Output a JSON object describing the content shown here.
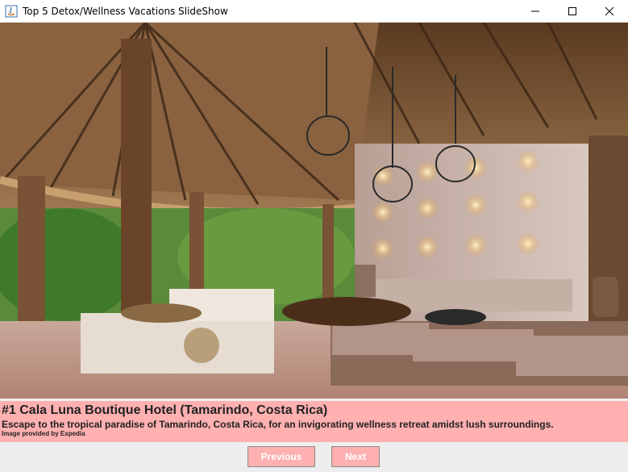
{
  "window": {
    "title": "Top 5 Detox/Wellness Vacations SlideShow",
    "controls": [
      "minimize-icon",
      "maximize-icon",
      "close-icon"
    ]
  },
  "slide": {
    "title": "#1 Cala Luna Boutique Hotel (Tamarindo, Costa Rica)",
    "description": "Escape to the tropical paradise of Tamarindo, Costa Rica, for an invigorating wellness retreat amidst lush surroundings.",
    "credit": "Image provided by Expedia"
  },
  "buttons": {
    "previous": "Previous",
    "next": "Next"
  },
  "colors": {
    "caption_bg": "#ffb0b0",
    "button_bg": "#ffb0b0",
    "button_text": "#ffffff"
  }
}
